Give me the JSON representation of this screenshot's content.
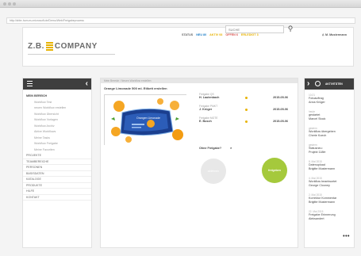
{
  "browser": {
    "url": "http://zbbr-hom.eu.microsoft.de/Demo/Web/Freigabeprozess"
  },
  "header": {
    "logo_text": "Z.B.",
    "logo_company": "COMPANY",
    "status_label": "STATUS",
    "status": [
      {
        "label": "NEU 80",
        "color": "#1f7fc7"
      },
      {
        "label": "AKTIV 93",
        "color": "#e7b200"
      },
      {
        "label": "OFFEN 6",
        "color": "#d9534f"
      },
      {
        "label": "ERLEDIGT 3",
        "color": "#e7b200"
      }
    ],
    "user": "M. Mustermann",
    "search_placeholder": "SUCHE"
  },
  "sidebar": {
    "items": [
      {
        "label": "MEIN BEREICH",
        "type": "head"
      },
      {
        "label": "Workflow Test",
        "type": "sub"
      },
      {
        "label": "neuen Workflow erstellen",
        "type": "sub"
      },
      {
        "label": "Workflow Übersicht",
        "type": "sub"
      },
      {
        "label": "Workflow Vorlagen",
        "type": "sub"
      },
      {
        "label": "Workflow Archiv",
        "type": "sub"
      },
      {
        "label": "Aktive Workflows",
        "type": "sub"
      },
      {
        "label": "Meine Tasks",
        "type": "sub"
      },
      {
        "label": "Workflow Freigabe",
        "type": "sub"
      },
      {
        "label": "Meine Favoriten",
        "type": "sub"
      },
      {
        "label": "PROJEKTE",
        "type": "top"
      },
      {
        "label": "TEAMBEREICHE",
        "type": "top"
      },
      {
        "label": "PERSONEN",
        "type": "top"
      },
      {
        "label": "BASISDATEN",
        "type": "top"
      },
      {
        "label": "KATALOGE",
        "type": "top"
      },
      {
        "label": "PRODUKTE",
        "type": "top"
      },
      {
        "label": "HILFE",
        "type": "top"
      },
      {
        "label": "KONTAKT",
        "type": "top"
      }
    ]
  },
  "main": {
    "breadcrumb": "Mein Bereich / Neuen Workflow erstellen",
    "title": "Orange Limonade 500 ml. Etikett erstellen",
    "fields": [
      {
        "key": "Freigabe QS",
        "value": "H. Lautenbach",
        "date": "2015-05-06"
      },
      {
        "key": "Freigabe PMKT",
        "value": "J. Krüger",
        "date": "2015-05-06"
      },
      {
        "key": "Freigabe MGTE",
        "value": "E. Busch",
        "date": "2015-05-06"
      }
    ],
    "freigabe_label": "Ohne Freigabe?",
    "freigabe_value": "×",
    "reject_label": "ablehnen",
    "approve_label": "freigeben",
    "product_text": "Orangen Limonade"
  },
  "activity": {
    "title": "AKTIVITÄTEN",
    "items": [
      {
        "time": "10:21",
        "lines": [
          "Fotoauftrag",
          "Anna Krüger"
        ]
      },
      {
        "time": "heute",
        "lines": [
          "gestartet",
          "Marcel Stock"
        ]
      },
      {
        "time": "gestern",
        "lines": [
          "Workflow übergeben",
          "Cherie Koech"
        ]
      },
      {
        "time": "gestern",
        "lines": [
          "Statusneu:",
          "Projekt 118fe"
        ]
      },
      {
        "time": "8. Mai 2015",
        "lines": [
          "Datenupload",
          "Brigitte Mustermann"
        ]
      },
      {
        "time": "4. Mai 2015",
        "lines": [
          "Workflow beantwortet",
          "George Clooney"
        ]
      },
      {
        "time": "2. Mai 2015",
        "lines": [
          "Korrektur Kommentar",
          "Brigitte Mustermann"
        ]
      },
      {
        "time": "22. Mai 2015",
        "lines": [
          "Freigabe Erinnerung",
          "Aleksandert"
        ]
      }
    ],
    "more": "•••"
  }
}
